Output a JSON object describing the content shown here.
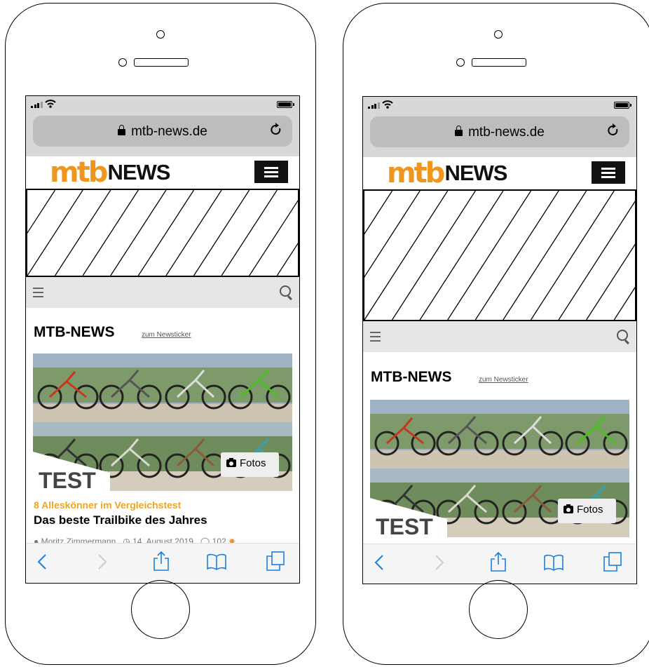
{
  "screens": [
    {
      "browser": {
        "url": "mtb-news.de",
        "reload_icon": "reload-icon"
      },
      "site": {
        "logo_mtb": "mtb",
        "logo_news": "NEWS"
      },
      "section": {
        "title": "MTB-NEWS",
        "link": "zum Newsticker"
      },
      "article": {
        "photo_tag": "TEST",
        "photo_button": "Fotos",
        "kicker": "8 Alleskönner im Vergleichstest",
        "headline": "Das beste Trailbike des Jahres",
        "author": "Moritz Zimmermann",
        "date": "14. August 2019",
        "comments": "102"
      }
    },
    {
      "browser": {
        "url": "mtb-news.de",
        "reload_icon": "reload-icon"
      },
      "site": {
        "logo_mtb": "mtb",
        "logo_news": "NEWS"
      },
      "section": {
        "title": "MTB-NEWS",
        "link": "zum Newsticker"
      },
      "article": {
        "photo_tag": "TEST",
        "photo_button": "Fotos"
      }
    }
  ],
  "colors": {
    "brand_orange": "#f0961e",
    "kicker_orange": "#f0a51e",
    "ios_blue": "#1b7fe0"
  },
  "toolbar_icons": [
    "back-icon",
    "forward-icon",
    "share-icon",
    "bookmarks-icon",
    "tabs-icon"
  ]
}
